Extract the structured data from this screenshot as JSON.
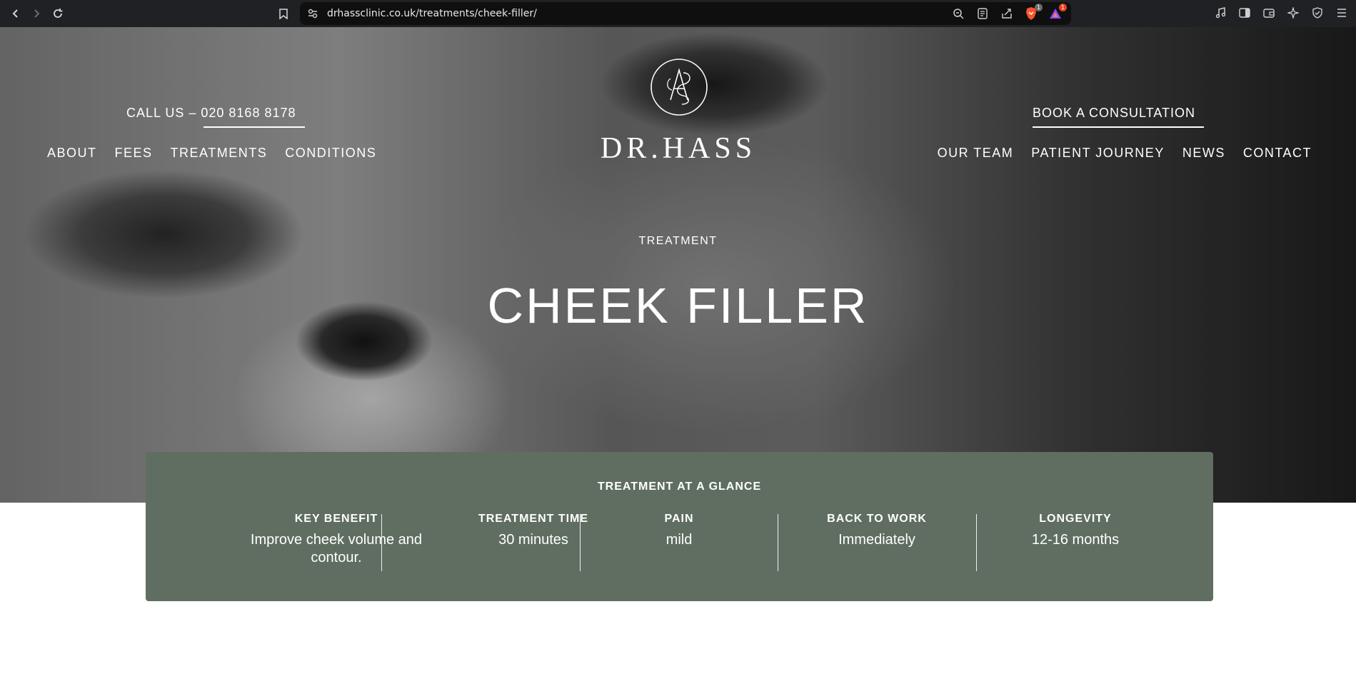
{
  "browser": {
    "url": "drhassclinic.co.uk/treatments/cheek-filler/",
    "brave_badge": "1",
    "rewards_badge": "1"
  },
  "header": {
    "call_us": "CALL US – 020 8168 8178",
    "book": "BOOK A CONSULTATION",
    "logo_text": "DR.HASS",
    "nav_left": [
      "ABOUT",
      "FEES",
      "TREATMENTS",
      "CONDITIONS"
    ],
    "nav_right": [
      "OUR TEAM",
      "PATIENT JOURNEY",
      "NEWS",
      "CONTACT"
    ]
  },
  "hero": {
    "eyebrow": "TREATMENT",
    "title": "CHEEK FILLER"
  },
  "glance": {
    "title": "TREATMENT AT A GLANCE",
    "items": [
      {
        "label": "KEY BENEFIT",
        "value": "Improve cheek volume and contour."
      },
      {
        "label": "TREATMENT TIME",
        "value": "30 minutes"
      },
      {
        "label": "PAIN",
        "value": "mild"
      },
      {
        "label": "BACK TO WORK",
        "value": "Immediately"
      },
      {
        "label": "LONGEVITY",
        "value": "12-16 months"
      }
    ]
  },
  "colors": {
    "glance_bg": "#5f6e61",
    "chrome_bg": "#202124"
  }
}
